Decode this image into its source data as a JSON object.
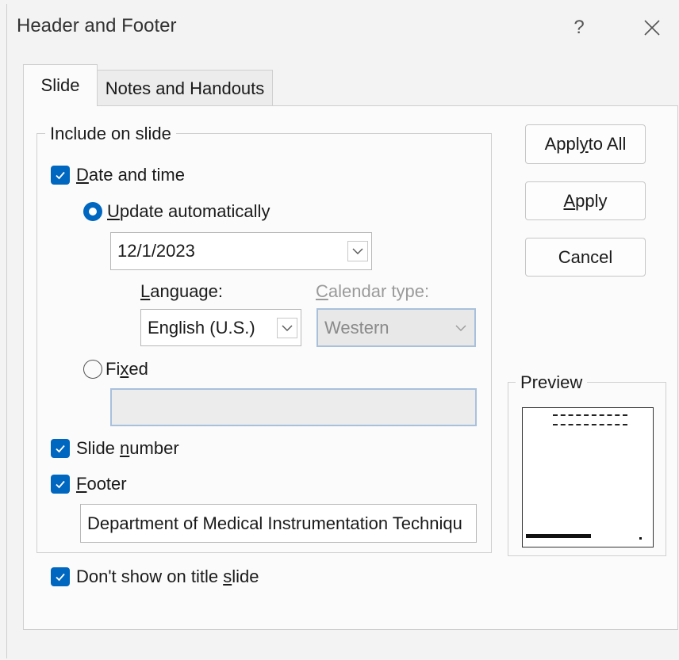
{
  "window": {
    "title": "Header and Footer",
    "help_label": "?",
    "colors": {
      "accent": "#0067c0",
      "background": "#f3f3f3",
      "panel": "#fbfbfb"
    }
  },
  "tabs": [
    {
      "label": "Slide",
      "selected": true
    },
    {
      "label": "Notes and Handouts",
      "selected": false
    }
  ],
  "include_group": {
    "legend": "Include on slide",
    "date_and_time": {
      "label_pre": "",
      "label_u": "D",
      "label_post": "ate and time",
      "checked": true
    },
    "update_automatically": {
      "label_pre": "",
      "label_u": "U",
      "label_post": "pdate automatically",
      "selected": true
    },
    "date_combo": {
      "value": "12/1/2023"
    },
    "language": {
      "label_pre": "",
      "label_u": "L",
      "label_post": "anguage:",
      "value": "English (U.S.)"
    },
    "calendar_type": {
      "label_pre": "",
      "label_u": "C",
      "label_post": "alendar type:",
      "value": "Western",
      "disabled": true
    },
    "fixed": {
      "label_pre": "Fi",
      "label_u": "x",
      "label_post": "ed",
      "selected": false,
      "value": ""
    },
    "slide_number": {
      "label_pre": "Slide ",
      "label_u": "n",
      "label_post": "umber",
      "checked": true
    },
    "footer": {
      "label_pre": "",
      "label_u": "F",
      "label_post": "ooter",
      "checked": true,
      "value": "Department of Medical Instrumentation Techniqu"
    }
  },
  "dont_show_title": {
    "label_pre": "Don't show on title ",
    "label_u": "s",
    "label_post": "lide",
    "checked": true
  },
  "buttons": {
    "apply_to_all": {
      "pre": "Appl",
      "u": "y",
      "post": " to All"
    },
    "apply": {
      "pre": "",
      "u": "A",
      "post": "pply"
    },
    "cancel": {
      "label": "Cancel"
    }
  },
  "preview": {
    "legend": "Preview"
  }
}
